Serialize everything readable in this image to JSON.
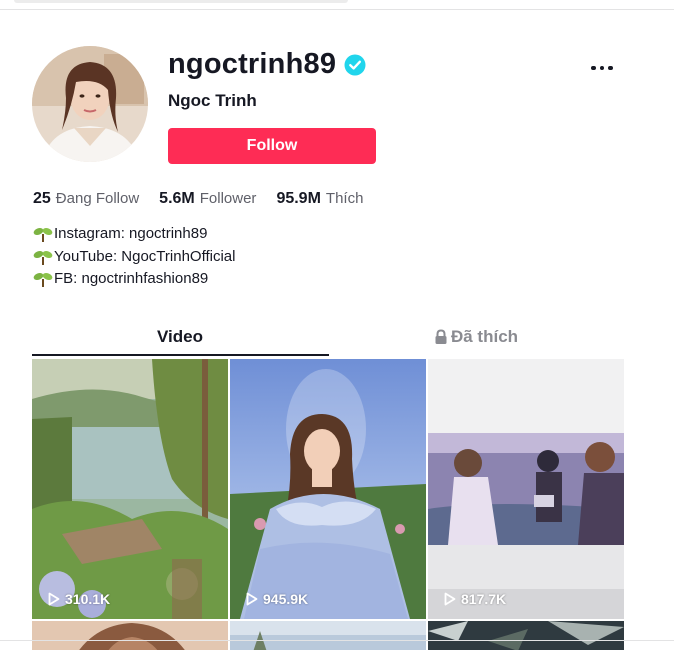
{
  "profile": {
    "username": "ngoctrinh89",
    "nickname": "Ngoc Trinh",
    "follow_label": "Follow"
  },
  "stats": [
    {
      "count": "25",
      "label": "Đang Follow"
    },
    {
      "count": "5.6M",
      "label": "Follower"
    },
    {
      "count": "95.9M",
      "label": "Thích"
    }
  ],
  "bio": [
    "Instagram: ngoctrinh89",
    "YouTube: NgocTrinhOfficial",
    "FB: ngoctrinhfashion89"
  ],
  "tabs": {
    "videos": "Video",
    "liked": "Đã thích"
  },
  "videos": [
    {
      "views": "310.1K",
      "scene": "lake-forest-landscape"
    },
    {
      "views": "945.9K",
      "scene": "woman-in-blue-dress-garden"
    },
    {
      "views": "817.7K",
      "scene": "couple-filming-field"
    },
    {
      "views": "",
      "scene": "partial-portrait"
    },
    {
      "views": "",
      "scene": "partial-sky"
    },
    {
      "views": "",
      "scene": "partial-plants"
    }
  ],
  "icons": {
    "verified": "verified-check-icon",
    "more": "more-options-icon",
    "bio_bullet": "sprout-icon",
    "liked_lock": "lock-icon",
    "views": "play-icon"
  },
  "colors": {
    "accent": "#fe2c55",
    "verified": "#20d5ec",
    "text": "#161823",
    "muted": "#8a8b91"
  }
}
